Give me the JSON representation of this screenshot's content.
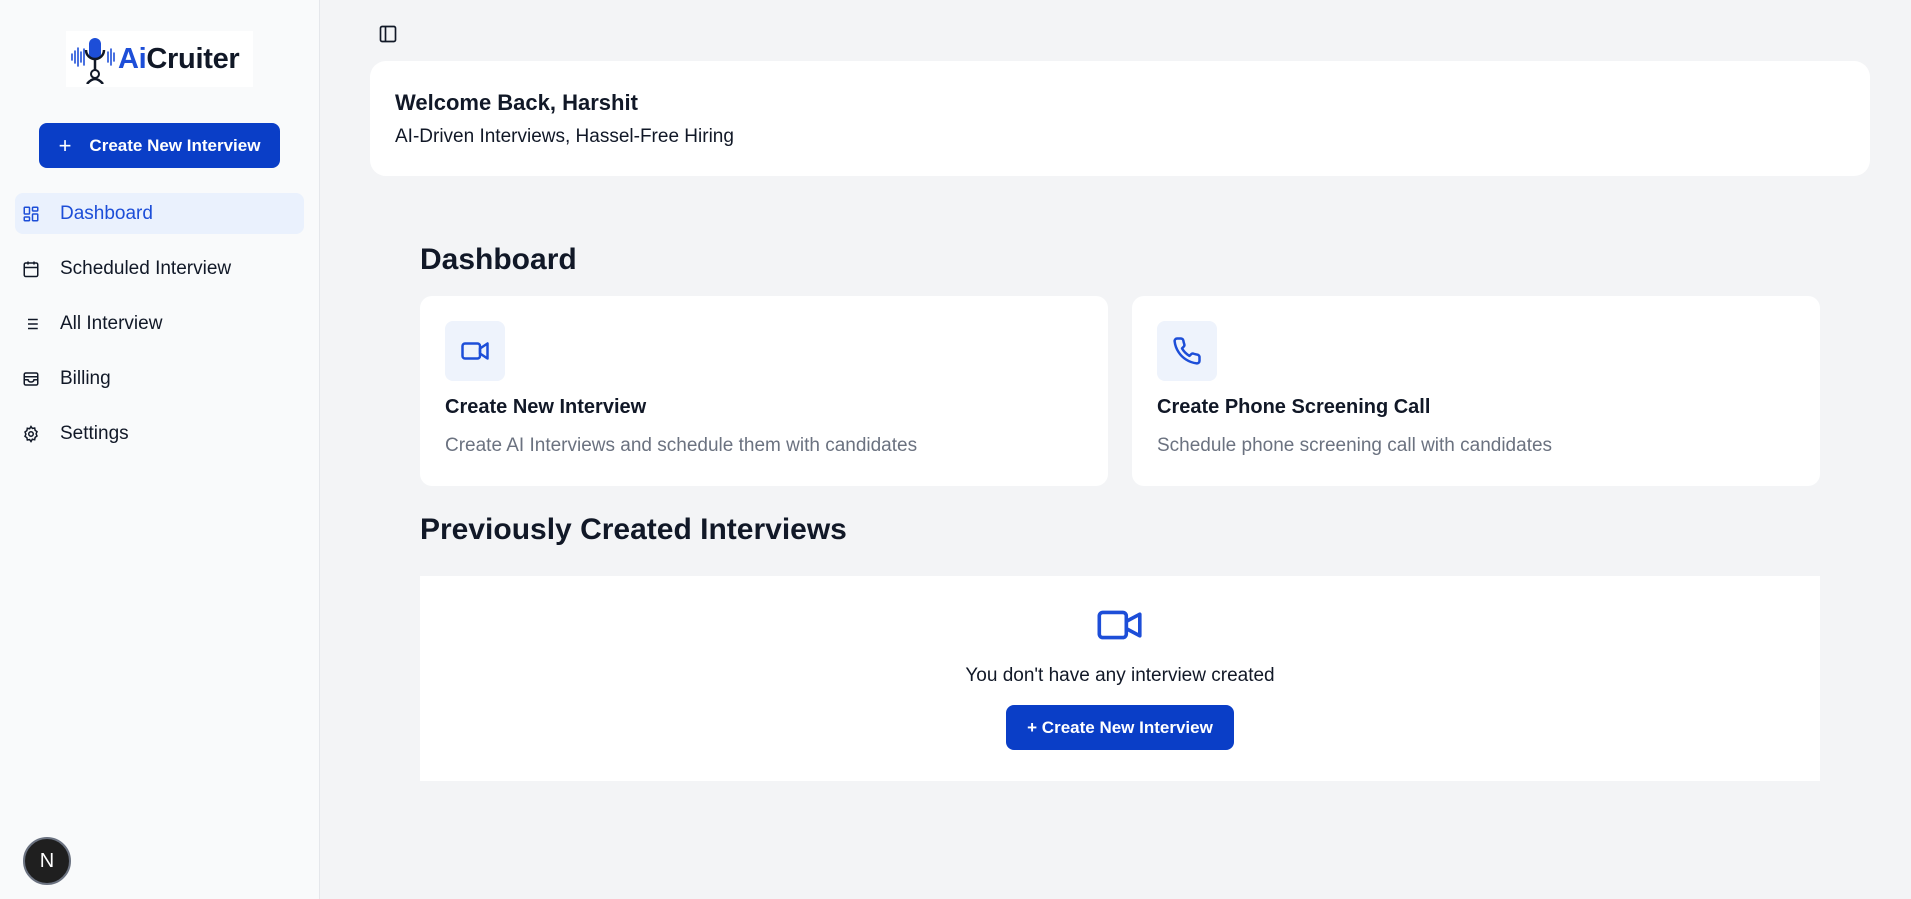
{
  "app": {
    "logo": {
      "ai": "Ai",
      "rest": "Cruiter"
    }
  },
  "sidebar": {
    "create_button": {
      "icon": "plus-icon",
      "label": "Create New Interview"
    },
    "items": [
      {
        "label": "Dashboard",
        "icon": "dashboard-grid-icon",
        "active": true
      },
      {
        "label": "Scheduled Interview",
        "icon": "calendar-icon",
        "active": false
      },
      {
        "label": "All Interview",
        "icon": "list-icon",
        "active": false
      },
      {
        "label": "Billing",
        "icon": "wallet-icon",
        "active": false
      },
      {
        "label": "Settings",
        "icon": "gear-icon",
        "active": false
      }
    ]
  },
  "header": {
    "toggle_icon": "sidebar-toggle-icon",
    "welcome_title": "Welcome Back, Harshit",
    "welcome_subtitle": "AI-Driven Interviews, Hassel-Free Hiring"
  },
  "dashboard": {
    "title": "Dashboard",
    "cards": [
      {
        "icon": "video-icon",
        "title": "Create New Interview",
        "description": "Create AI Interviews and schedule them with candidates"
      },
      {
        "icon": "phone-icon",
        "title": "Create Phone Screening Call",
        "description": "Schedule phone screening call with candidates"
      }
    ]
  },
  "previous": {
    "title": "Previously Created Interviews",
    "empty_icon": "video-icon",
    "empty_text": "You don't have any interview created",
    "button_label": "+ Create New Interview"
  },
  "dev_badge": {
    "label": "N"
  },
  "colors": {
    "primary": "#0a3ec7",
    "accent": "#1d4ed8",
    "active_bg": "#eaf1fd",
    "page_bg": "#f3f4f6",
    "muted_text": "#6b7280"
  }
}
